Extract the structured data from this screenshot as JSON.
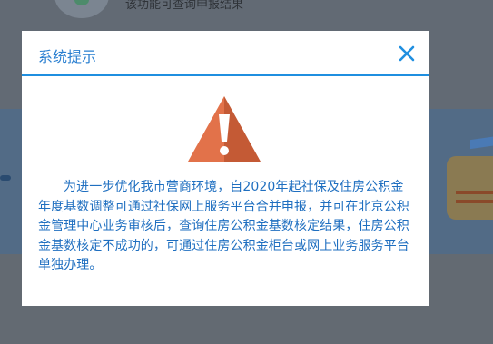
{
  "background": {
    "notice_text": "该功能可查询申报结果"
  },
  "dialog": {
    "title": "系统提示",
    "close_icon": "close-icon",
    "warning_icon": "warning-triangle-icon",
    "message": "为进一步优化我市营商环境，自2020年起社保及住房公积金年度基数调整可通过社保网上服务平台合并申报，并可在北京公积金管理中心业务审核后，查询住房公积金基数核定结果，住房公积金基数核定不成功的，可通过住房公积金柜台或网上业务服务平台单独办理。"
  },
  "colors": {
    "accent": "#1f8fe0",
    "title": "#2a7fd0",
    "message": "#1f6fc0",
    "warning_light": "#e2724a",
    "warning_dark": "#c45a35"
  }
}
